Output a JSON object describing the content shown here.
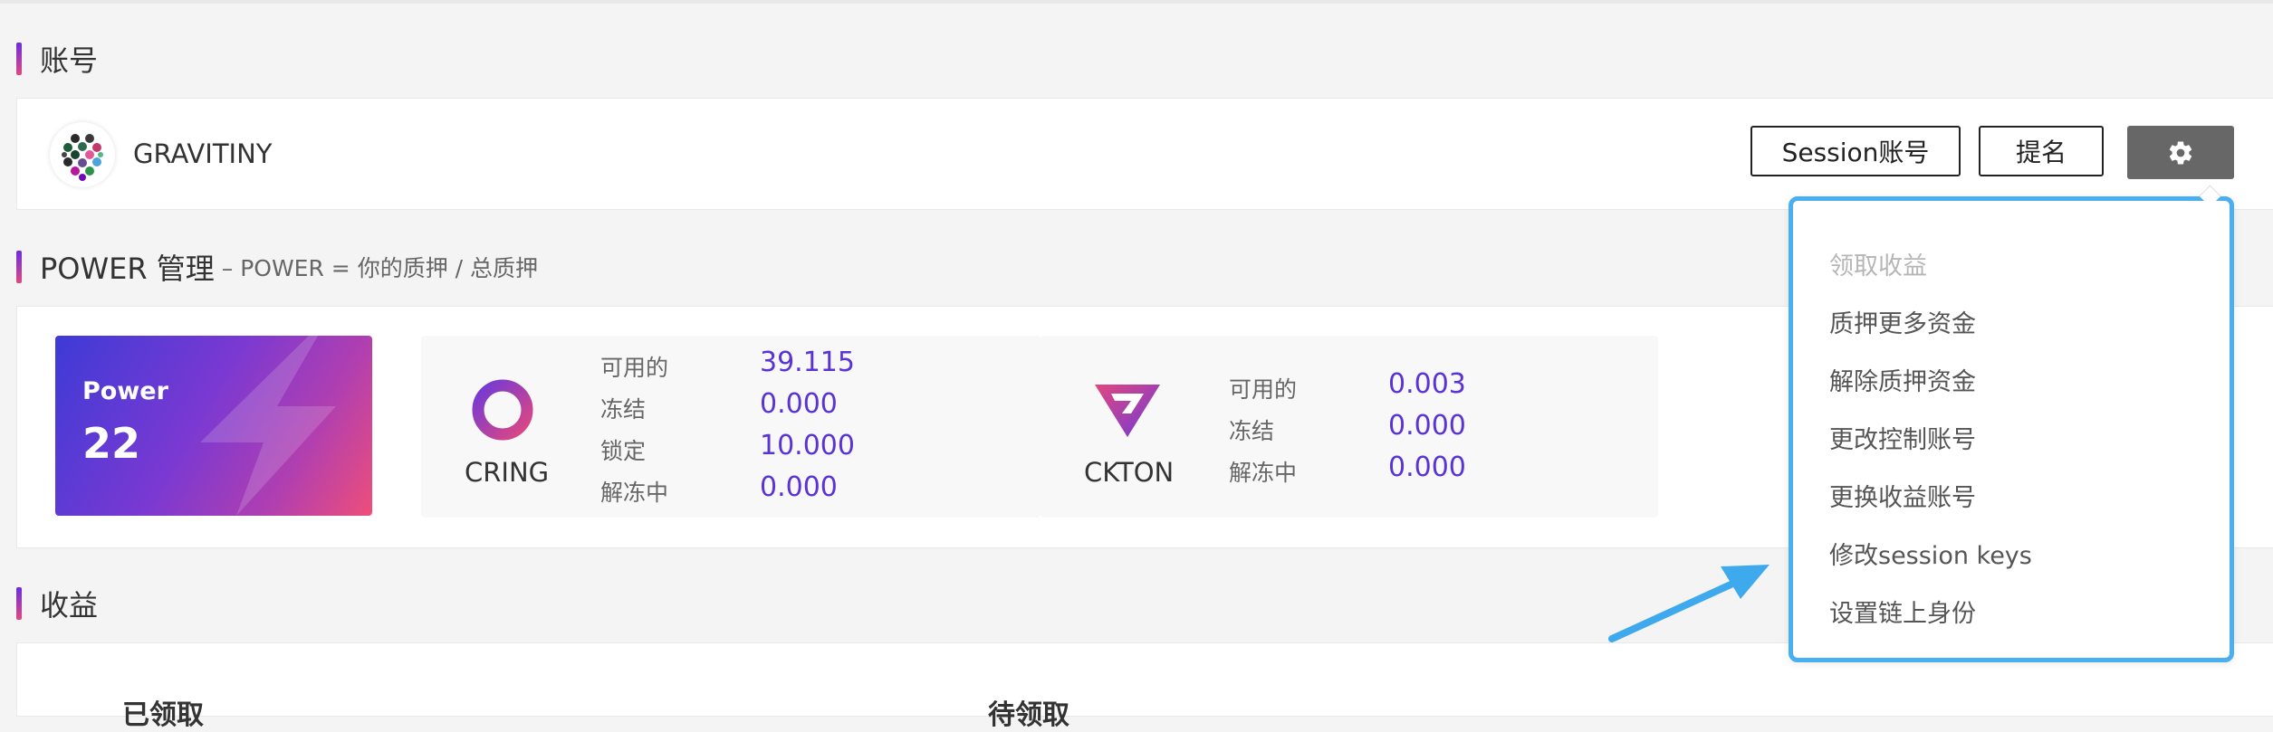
{
  "account": {
    "section_title": "账号",
    "name": "GRAVITINY",
    "session_button": "Session账号",
    "nominate_button": "提名"
  },
  "power": {
    "section_title": "POWER 管理",
    "section_subtitle": "– POWER = 你的质押 / 总质押",
    "label": "Power",
    "value": "22"
  },
  "tokens": [
    {
      "name": "CRING",
      "stats": [
        {
          "label": "可用的",
          "value": "39.115"
        },
        {
          "label": "冻结",
          "value": "0.000"
        },
        {
          "label": "锁定",
          "value": "10.000"
        },
        {
          "label": "解冻中",
          "value": "0.000"
        }
      ]
    },
    {
      "name": "CKTON",
      "stats": [
        {
          "label": "可用的",
          "value": "0.003"
        },
        {
          "label": "冻结",
          "value": "0.000"
        },
        {
          "label": "解冻中",
          "value": "0.000"
        }
      ]
    }
  ],
  "menu": {
    "items": [
      {
        "label": "领取收益",
        "disabled": true
      },
      {
        "label": "质押更多资金",
        "disabled": false
      },
      {
        "label": "解除质押资金",
        "disabled": false
      },
      {
        "label": "更改控制账号",
        "disabled": false
      },
      {
        "label": "更换收益账号",
        "disabled": false
      },
      {
        "label": "修改session keys",
        "disabled": false
      },
      {
        "label": "设置链上身份",
        "disabled": false
      }
    ]
  },
  "income": {
    "section_title": "收益",
    "claimed_label": "已领取",
    "pending_label": "待领取"
  },
  "colors": {
    "accent_purple": "#5a33d6",
    "callout_blue": "#4aaff0",
    "gear_button_bg": "#676767"
  },
  "icons": {
    "gear": "gear-icon",
    "avatar": "identicon-avatar",
    "cring": "cring-ring-icon",
    "ckton": "ckton-shield-icon",
    "power": "lightning-bolt-icon"
  }
}
